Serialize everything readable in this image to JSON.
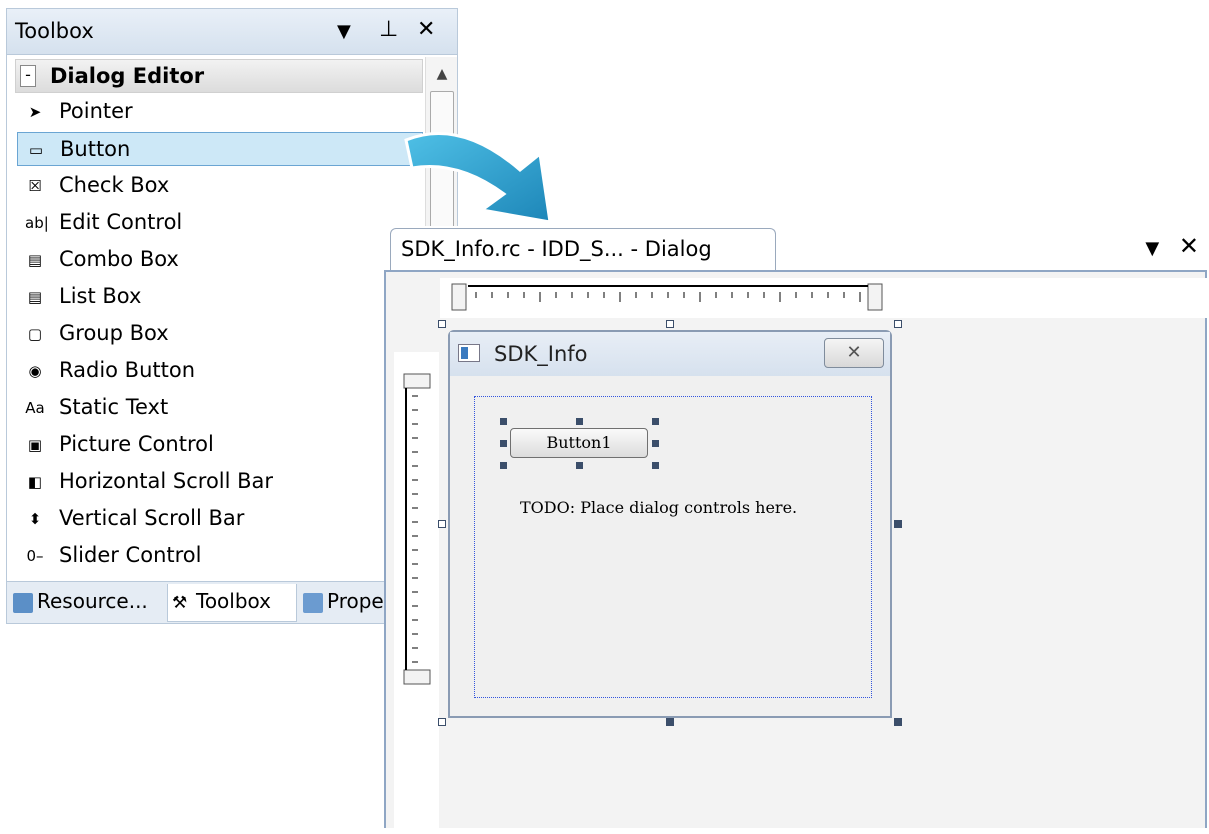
{
  "toolbox": {
    "title": "Toolbox",
    "section": "Dialog Editor",
    "items": [
      {
        "label": "Pointer",
        "icon": "pointer-icon",
        "glyph": "➤"
      },
      {
        "label": "Button",
        "icon": "button-icon",
        "glyph": "▭",
        "selected": true
      },
      {
        "label": "Check Box",
        "icon": "check-box-icon",
        "glyph": "☒"
      },
      {
        "label": "Edit Control",
        "icon": "edit-control-icon",
        "glyph": "ab|"
      },
      {
        "label": "Combo Box",
        "icon": "combo-box-icon",
        "glyph": "▤"
      },
      {
        "label": "List Box",
        "icon": "list-box-icon",
        "glyph": "▤"
      },
      {
        "label": "Group Box",
        "icon": "group-box-icon",
        "glyph": "▢"
      },
      {
        "label": "Radio Button",
        "icon": "radio-button-icon",
        "glyph": "◉"
      },
      {
        "label": "Static Text",
        "icon": "static-text-icon",
        "glyph": "Aa"
      },
      {
        "label": "Picture Control",
        "icon": "picture-control-icon",
        "glyph": "▣"
      },
      {
        "label": "Horizontal Scroll Bar",
        "icon": "horizontal-scroll-bar-icon",
        "glyph": "◧"
      },
      {
        "label": "Vertical Scroll Bar",
        "icon": "vertical-scroll-bar-icon",
        "glyph": "⬍"
      },
      {
        "label": "Slider Control",
        "icon": "slider-control-icon",
        "glyph": "0–"
      }
    ],
    "tabs": [
      {
        "label": "Resource...",
        "icon": "resource-view-icon"
      },
      {
        "label": "Toolbox",
        "icon": "toolbox-icon",
        "active": true
      },
      {
        "label": "Prope",
        "icon": "properties-icon"
      }
    ],
    "controls": {
      "dropdown": "▼",
      "pin": "⊥",
      "close": "✕"
    }
  },
  "editor": {
    "tab_label": "SDK_Info.rc - IDD_S...  - Dialog",
    "controls": {
      "dropdown": "▼",
      "close": "✕"
    }
  },
  "dialog": {
    "title": "SDK_Info",
    "close_glyph": "✕",
    "button_label": "Button1",
    "static_text": "TODO: Place dialog controls here."
  },
  "colors": {
    "selection": "#cde8f7",
    "arrow": "#3aa6d4",
    "handle": "#3b4e6a"
  }
}
